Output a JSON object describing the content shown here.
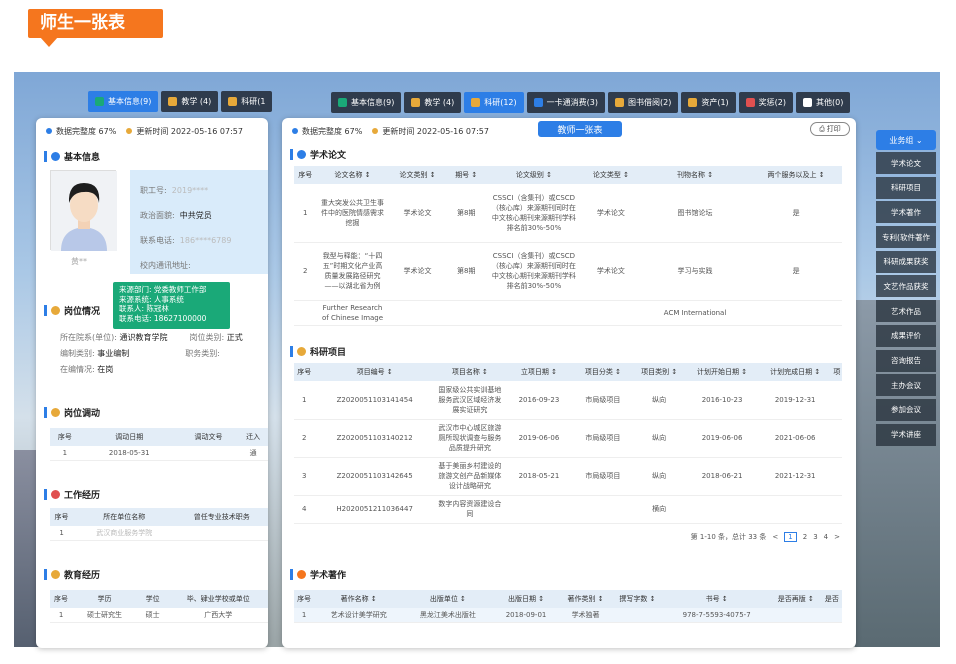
{
  "banner": {
    "title": "师生一张表"
  },
  "back": {
    "tabs": [
      {
        "label": "基本信息(9)",
        "color": "#1aa978"
      },
      {
        "label": "教学 (4)",
        "color": "#e7a93a"
      },
      {
        "label": "科研(1",
        "color": "#e7a93a"
      }
    ],
    "completeness": "数据完整度 67%",
    "updated": "更新时间 2022-05-16 07:57",
    "basic": {
      "title": "基本信息",
      "name": "黄**",
      "fields": [
        {
          "k": "职工号:",
          "v": "2019****"
        },
        {
          "k": "政治面貌:",
          "v": "中共党员"
        },
        {
          "k": "联系电话:",
          "v": "186****6789"
        },
        {
          "k": "校内通讯地址:",
          "v": ""
        }
      ]
    },
    "tooltip": [
      "来源部门: 党委教师工作部",
      "来源系统: 人事系统",
      "联系人:  陈冠林",
      "联系电话: 18627100000"
    ],
    "post": {
      "title": "岗位情况",
      "fields": [
        {
          "k": "所在院系(单位):",
          "v": "通识教育学院"
        },
        {
          "k": "岗位类别:",
          "v": "正式"
        },
        {
          "k": "编制类别:",
          "v": "事业编制"
        },
        {
          "k": "职务类别:",
          "v": ""
        },
        {
          "k": "在编情况:",
          "v": "在岗"
        }
      ]
    },
    "transfer": {
      "title": "岗位调动",
      "headers": [
        "序号",
        "调动日期",
        "调动文号",
        "迁入"
      ],
      "rows": [
        [
          "1",
          "2018-05-31",
          "",
          "通"
        ]
      ]
    },
    "work": {
      "title": "工作经历",
      "headers": [
        "序号",
        "所在单位名称",
        "曾任专业技术职务"
      ],
      "rows": [
        [
          "1",
          "武汉商业服务学院",
          ""
        ]
      ]
    },
    "edu": {
      "title": "教育经历",
      "headers": [
        "序号",
        "学历",
        "学位",
        "毕、肄业学校或单位"
      ],
      "rows": [
        [
          "1",
          "硕士研究生",
          "硕士",
          "广西大学"
        ]
      ]
    }
  },
  "front": {
    "tabs": [
      {
        "label": "基本信息(9)",
        "color": "#1aa978"
      },
      {
        "label": "教学 (4)",
        "color": "#e7a93a"
      },
      {
        "label": "科研(12)",
        "color": "#e7a93a",
        "active": true
      },
      {
        "label": "一卡通消费(3)",
        "color": "#2d7ee6"
      },
      {
        "label": "图书借阅(2)",
        "color": "#e7a93a"
      },
      {
        "label": "资产(1)",
        "color": "#e7a93a"
      },
      {
        "label": "奖惩(2)",
        "color": "#e05050"
      },
      {
        "label": "其他(0)",
        "color": "#ffffff"
      }
    ],
    "completeness": "数据完整度 67%",
    "updated": "更新时间 2022-05-16 07:57",
    "center_title": "教师一张表",
    "print": "打印",
    "papers": {
      "title": "学术论文",
      "headers": [
        "序号",
        "论文名称 ↕",
        "论文类别 ↕",
        "期号 ↕",
        "论文级别 ↕",
        "论文类型 ↕",
        "刊物名称 ↕",
        "两个服务以及上 ↕"
      ],
      "rows": [
        [
          "1",
          "重大突发公共卫生事件中的医院情感需求挖掘",
          "学术论文",
          "第8期",
          "CSSCI（含集刊）或CSCD（核心库）来源期刊同时在中文核心期刊来源期刊学科排名前30%-50%",
          "学术论文",
          "图书馆论坛",
          "是"
        ],
        [
          "2",
          "我型与释能：“十四五”时期文化产业高质量发展路径研究——以湖北省为例",
          "学术论文",
          "第8期",
          "CSSCI（含集刊）或CSCD（核心库）来源期刊同时在中文核心期刊来源期刊学科排名前30%-50%",
          "学术论文",
          "学习与实践",
          "是"
        ],
        [
          "",
          "Further Research of Chinese Image",
          "",
          "",
          "",
          "",
          "ACM International",
          ""
        ]
      ]
    },
    "projects": {
      "title": "科研项目",
      "headers": [
        "序号",
        "项目编号 ↕",
        "项目名称 ↕",
        "立项日期 ↕",
        "项目分类 ↕",
        "项目类别 ↕",
        "计划开始日期 ↕",
        "计划完成日期 ↕",
        "项"
      ],
      "rows": [
        [
          "1",
          "Z2020051103141454",
          "国家级公共实训基地服务武汉区域经济发展实证研究",
          "2016-09-23",
          "市局级项目",
          "纵向",
          "2016-10-23",
          "2019-12-31",
          ""
        ],
        [
          "2",
          "Z2020051103140212",
          "武汉市中心城区旅游厕所现状调查与服务品质提升研究",
          "2019-06-06",
          "市局级项目",
          "纵向",
          "2019-06-06",
          "2021-06-06",
          ""
        ],
        [
          "3",
          "Z2020051103142645",
          "基于美丽乡村建设的旅游文创产品新媒体设计战略研究",
          "2018-05-21",
          "市局级项目",
          "纵向",
          "2018-06-21",
          "2021-12-31",
          ""
        ],
        [
          "4",
          "H2020051211036447",
          "数字内容资源建设合同",
          "",
          "",
          "横向",
          "",
          "",
          ""
        ]
      ],
      "pager": {
        "summary": "第 1-10 条，总计 33 条",
        "pages": [
          "<",
          "1",
          "2",
          "3",
          "4",
          ">"
        ]
      }
    },
    "books": {
      "title": "学术著作",
      "headers": [
        "序号",
        "著作名称 ↕",
        "出版单位 ↕",
        "出版日期 ↕",
        "著作类别 ↕",
        "撰写字数 ↕",
        "书号 ↕",
        "是否再版 ↕",
        "是否"
      ],
      "rows": [
        [
          "1",
          "艺术设计美学研究",
          "黑龙江美术出版社",
          "2018-09-01",
          "学术独著",
          "",
          "978-7-5593-4075-7",
          "",
          ""
        ]
      ]
    }
  },
  "sidebar": {
    "header": "业务组 ⌄",
    "items": [
      "学术论文",
      "科研项目",
      "学术著作",
      "专利(软件著作",
      "科研成果获奖",
      "文艺作品获奖",
      "艺术作品",
      "成果评价",
      "咨询报告",
      "主办会议",
      "参加会议",
      "学术讲座"
    ]
  }
}
